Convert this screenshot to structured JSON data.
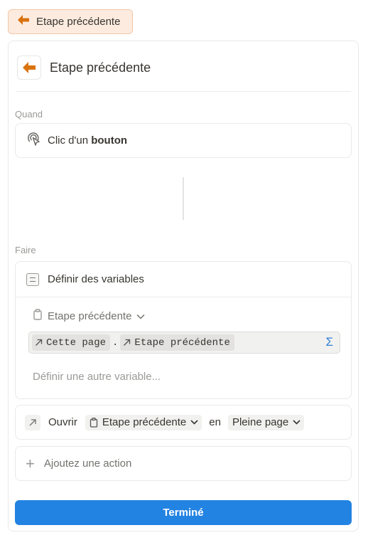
{
  "top_chip": {
    "label": "Etape précédente",
    "icon": "arrow-left-icon"
  },
  "header": {
    "title": "Etape précédente",
    "icon": "arrow-left-icon"
  },
  "when": {
    "section_label": "Quand",
    "trigger_prefix": "Clic d'un ",
    "trigger_bold": "bouton",
    "icon": "cursor-click-icon"
  },
  "do": {
    "section_label": "Faire",
    "set_variables": {
      "label": "Définir des variables",
      "icon": "list-icon",
      "variable_name": "Etape précédente",
      "formula_tokens": [
        "Cette page",
        "Etape précédente"
      ],
      "formula_separator": ".",
      "formula_button": "Σ",
      "add_variable": "Définir une autre variable..."
    },
    "open": {
      "label": "Ouvrir",
      "icon": "arrow-up-right-icon",
      "target": "Etape précédente",
      "connector": "en",
      "mode": "Pleine page"
    },
    "add_action": {
      "label": "Ajoutez une action",
      "icon": "plus-icon"
    }
  },
  "done_button": "Terminé",
  "colors": {
    "accent": "#2383e2",
    "brand_orange": "#d9730d",
    "chip_bg": "#fdebe0"
  }
}
